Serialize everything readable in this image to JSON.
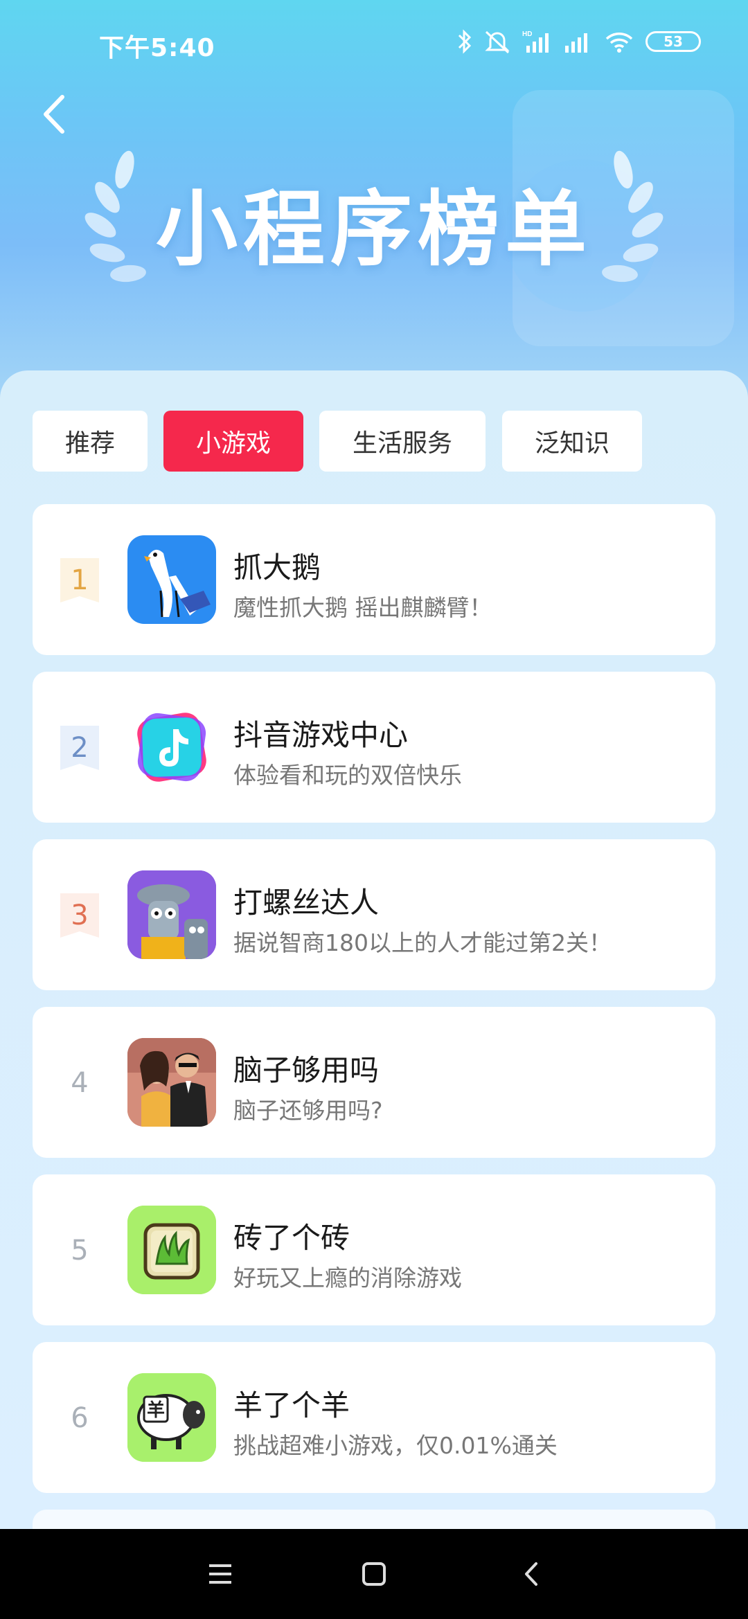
{
  "status_bar": {
    "time": "下午5:40",
    "battery": "53",
    "icons": [
      "bluetooth-icon",
      "mute-icon",
      "hd-signal-icon",
      "signal-icon",
      "wifi-icon",
      "battery-icon"
    ]
  },
  "header": {
    "title": "小程序榜单",
    "back_icon": "chevron-left-icon"
  },
  "tabs": [
    {
      "label": "推荐",
      "active": false
    },
    {
      "label": "小游戏",
      "active": true
    },
    {
      "label": "生活服务",
      "active": false
    },
    {
      "label": "泛知识",
      "active": false
    }
  ],
  "list": [
    {
      "rank": "1",
      "name": "抓大鹅",
      "desc": "魔性抓大鹅 摇出麒麟臂！",
      "icon": "goose-icon"
    },
    {
      "rank": "2",
      "name": "抖音游戏中心",
      "desc": "体验看和玩的双倍快乐",
      "icon": "douyin-icon"
    },
    {
      "rank": "3",
      "name": "打螺丝达人",
      "desc": "据说智商180以上的人才能过第2关！",
      "icon": "screw-robot-icon"
    },
    {
      "rank": "4",
      "name": "脑子够用吗",
      "desc": "脑子还够用吗?",
      "icon": "couple-icon"
    },
    {
      "rank": "5",
      "name": "砖了个砖",
      "desc": "好玩又上瘾的消除游戏",
      "icon": "grass-tile-icon"
    },
    {
      "rank": "6",
      "name": "羊了个羊",
      "desc": "挑战超难小游戏，仅0.01%通关",
      "icon": "sheep-icon",
      "icon_text": "羊"
    }
  ],
  "colors": {
    "active_tab": "#f5284c",
    "rank1": "#e3a543",
    "rank2": "#6d8fc6",
    "rank3": "#e06f52"
  },
  "nav": [
    "menu-icon",
    "home-icon",
    "back-icon"
  ]
}
